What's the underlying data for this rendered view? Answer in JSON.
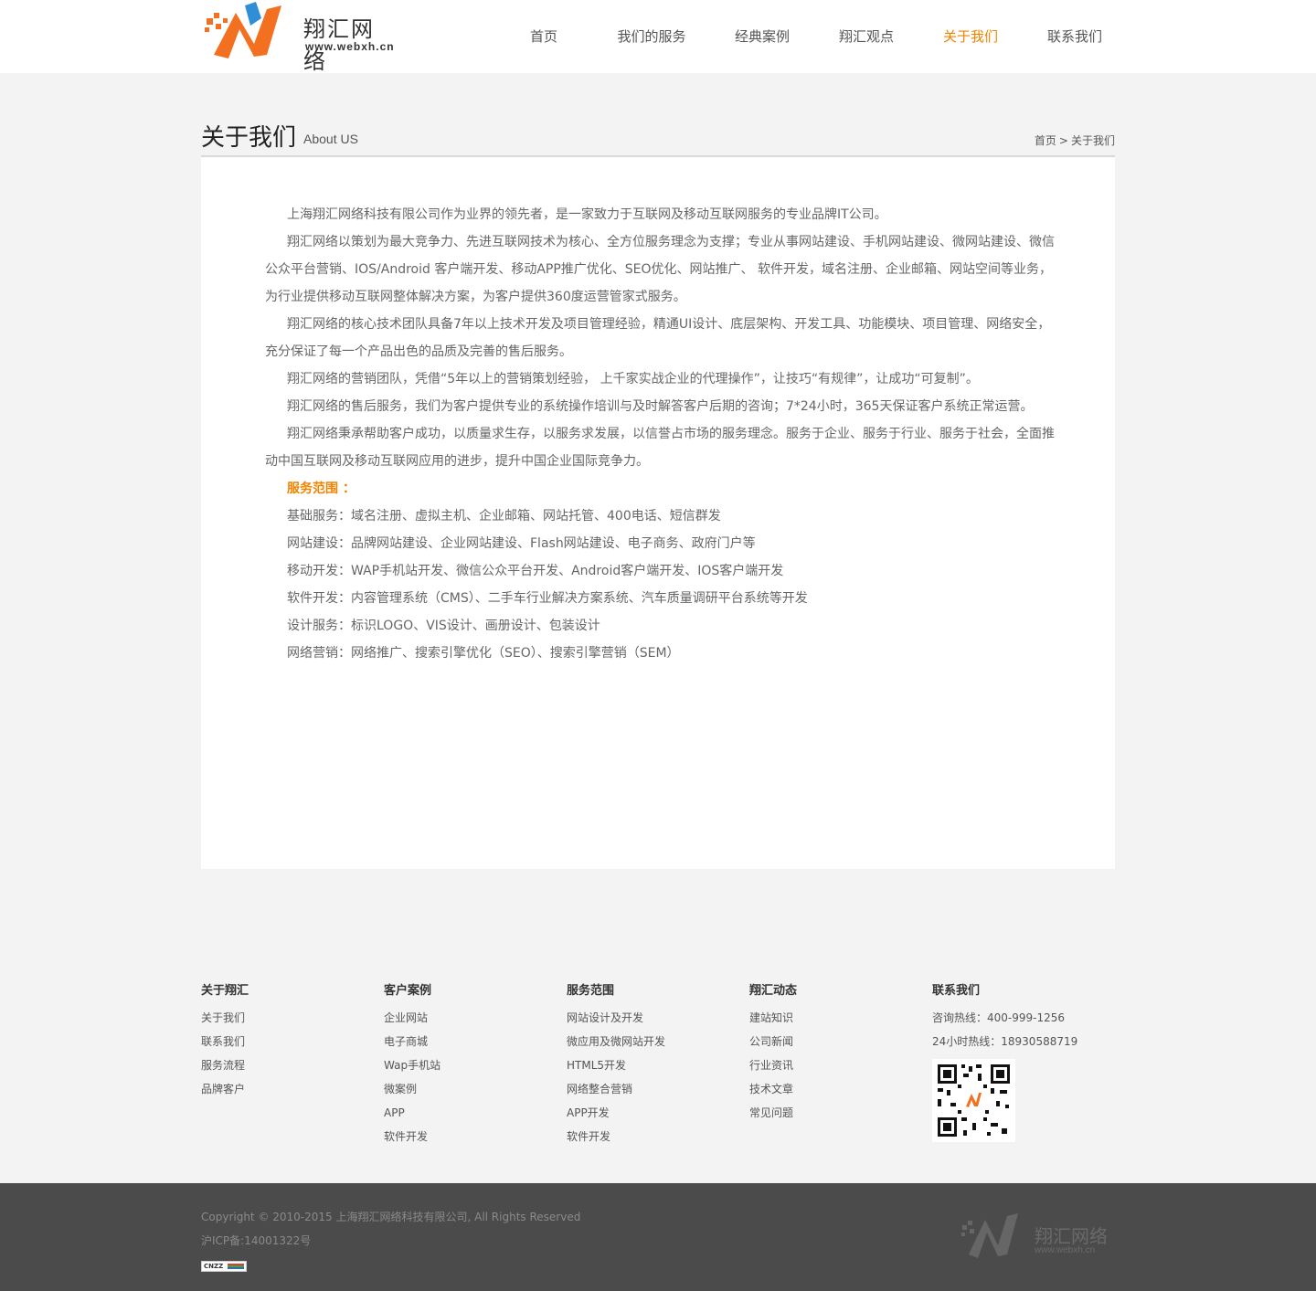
{
  "brand": {
    "name": "翔汇网络",
    "url": "www.webxh.cn",
    "accent": "#f08300",
    "accent_blue": "#2f8fd6"
  },
  "nav": [
    {
      "label": "首页",
      "active": false
    },
    {
      "label": "我们的服务",
      "active": false
    },
    {
      "label": "经典案例",
      "active": false
    },
    {
      "label": "翔汇观点",
      "active": false
    },
    {
      "label": "关于我们",
      "active": true
    },
    {
      "label": "联系我们",
      "active": false
    }
  ],
  "page": {
    "title": "关于我们",
    "subtitle": "About US"
  },
  "breadcrumb": {
    "home": "首页",
    "sep": ">",
    "current": "关于我们"
  },
  "article": {
    "paragraphs": [
      "上海翔汇网络科技有限公司作为业界的领先者，是一家致力于互联网及移动互联网服务的专业品牌IT公司。",
      "翔汇网络以策划为最大竞争力、先进互联网技术为核心、全方位服务理念为支撑；专业从事网站建设、手机网站建设、微网站建设、微信公众平台营销、IOS/Android 客户端开发、移动APP推广优化、SEO优化、网站推广、 软件开发，域名注册、企业邮箱、网站空间等业务，为行业提供移动互联网整体解决方案，为客户提供360度运营管家式服务。",
      "翔汇网络的核心技术团队具备7年以上技术开发及项目管理经验，精通UI设计、底层架构、开发工具、功能模块、项目管理、网络安全，充分保证了每一个产品出色的品质及完善的售后服务。",
      "翔汇网络的营销团队，凭借“5年以上的营销策划经验， 上千家实战企业的代理操作”，让技巧“有规律”，让成功“可复制”。",
      "翔汇网络的售后服务，我们为客户提供专业的系统操作培训与及时解答客户后期的咨询；7*24小时，365天保证客户系统正常运营。",
      "翔汇网络秉承帮助客户成功，以质量求生存，以服务求发展，以信誉占市场的服务理念。服务于企业、服务于行业、服务于社会，全面推动中国互联网及移动互联网应用的进步，提升中国企业国际竞争力。"
    ],
    "services_heading": "服务范围 ：",
    "services": [
      "基础服务：域名注册、虚拟主机、企业邮箱、网站托管、400电话、短信群发",
      "网站建设：品牌网站建设、企业网站建设、Flash网站建设、电子商务、政府门户等",
      "移动开发：WAP手机站开发、微信公众平台开发、Android客户端开发、IOS客户端开发",
      "软件开发：内容管理系统（CMS）、二手车行业解决方案系统、汽车质量调研平台系统等开发",
      "设计服务：标识LOGO、VIS设计、画册设计、包装设计",
      "网络营销：网络推广、搜索引擎优化（SEO）、搜索引擎营销（SEM）"
    ]
  },
  "footer": {
    "cols": [
      {
        "title": "关于翔汇",
        "links": [
          "关于我们",
          "联系我们",
          "服务流程",
          "品牌客户"
        ]
      },
      {
        "title": "客户案例",
        "links": [
          "企业网站",
          "电子商城",
          "Wap手机站",
          "微案例",
          "APP",
          "软件开发"
        ]
      },
      {
        "title": "服务范围",
        "links": [
          "网站设计及开发",
          "微应用及微网站开发",
          "HTML5开发",
          "网络整合营销",
          "APP开发",
          "软件开发"
        ]
      },
      {
        "title": "翔汇动态",
        "links": [
          "建站知识",
          "公司新闻",
          "行业资讯",
          "技术文章",
          "常见问题"
        ]
      }
    ],
    "contact": {
      "title": "联系我们",
      "hotline": "咨询热线：400-999-1256",
      "hotline24": "24小时热线：18930588719"
    }
  },
  "bottom": {
    "copyright": "Copyright © 2010-2015 上海翔汇网络科技有限公司, All Rights Reserved",
    "icp": "沪ICP备:14001322号",
    "badge": "CNZZ"
  }
}
